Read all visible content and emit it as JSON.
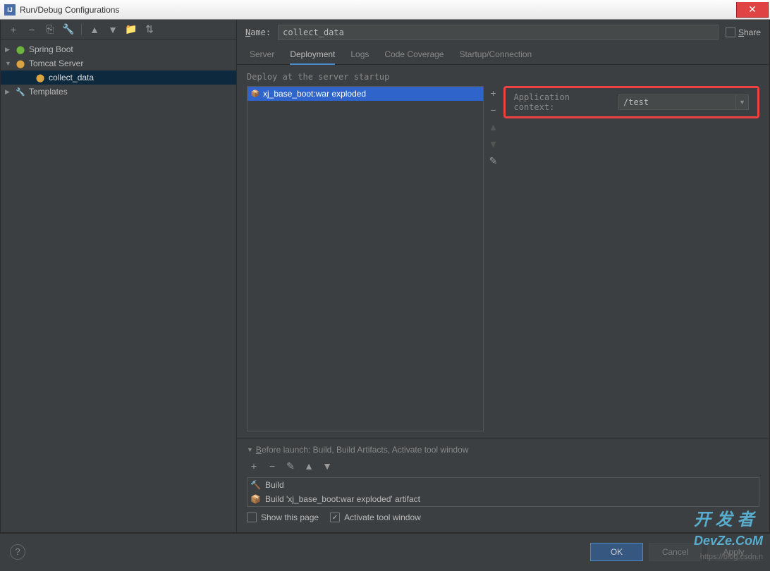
{
  "window": {
    "title": "Run/Debug Configurations"
  },
  "sidebar": {
    "items": [
      {
        "label": "Spring Boot",
        "expanded": false,
        "icon": "🍃"
      },
      {
        "label": "Tomcat Server",
        "expanded": true,
        "icon": "🐱"
      },
      {
        "label": "collect_data",
        "selected": true,
        "icon": "🐱"
      },
      {
        "label": "Templates",
        "expanded": false,
        "icon": "🔧"
      }
    ]
  },
  "form": {
    "name_label": "Name:",
    "name_value": "collect_data",
    "share_label": "Share"
  },
  "tabs": {
    "server": "Server",
    "deployment": "Deployment",
    "logs": "Logs",
    "code_coverage": "Code Coverage",
    "startup_connection": "Startup/Connection"
  },
  "deployment": {
    "heading": "Deploy at the server startup",
    "artifact": "xj_base_boot:war exploded",
    "appctx_label": "Application context:",
    "appctx_value": "/test"
  },
  "before_launch": {
    "heading": "Before launch: Build, Build Artifacts, Activate tool window",
    "items": [
      {
        "label": "Build",
        "icon": "🔨"
      },
      {
        "label": "Build 'xj_base_boot:war exploded' artifact",
        "icon": "📦"
      }
    ],
    "show_page_label": "Show this page",
    "activate_label": "Activate tool window"
  },
  "footer": {
    "ok": "OK",
    "cancel": "Cancel",
    "apply": "Apply"
  },
  "watermark": {
    "main": "开 发 者",
    "sub": "DevZe.CoM",
    "url": "https://blog.csdn.n"
  }
}
